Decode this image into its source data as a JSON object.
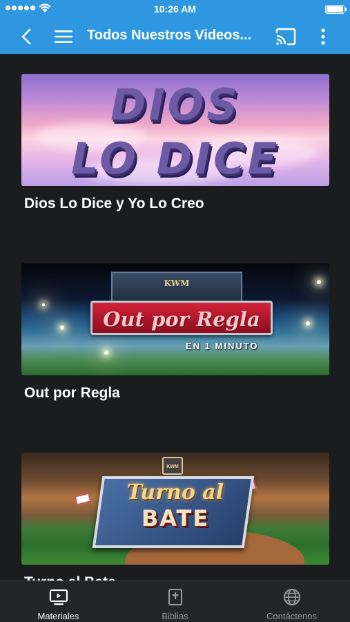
{
  "status_bar": {
    "time": "10:26 AM"
  },
  "app_bar": {
    "title": "Todos Nuestros Videos..."
  },
  "videos": [
    {
      "title": "Dios Lo Dice y Yo Lo Creo",
      "thumb_text_1": "DIOS",
      "thumb_text_2": "LO DICE"
    },
    {
      "title": "Out por Regla",
      "thumb_logo": "KWM",
      "thumb_banner": "Out por Regla",
      "thumb_sub": "EN 1 MINUTO"
    },
    {
      "title": "Turno al Bate",
      "thumb_logo": "KWM",
      "thumb_text_1": "Turno al",
      "thumb_text_2": "BATE"
    }
  ],
  "tabs": [
    {
      "label": "Materiales",
      "icon": "tv-play-icon",
      "active": true
    },
    {
      "label": "Biblias",
      "icon": "bible-icon",
      "active": false
    },
    {
      "label": "Contáctenos",
      "icon": "globe-icon",
      "active": false
    }
  ],
  "colors": {
    "accent": "#2f97df",
    "background": "#1b1c1e",
    "tabbar": "#242527"
  }
}
